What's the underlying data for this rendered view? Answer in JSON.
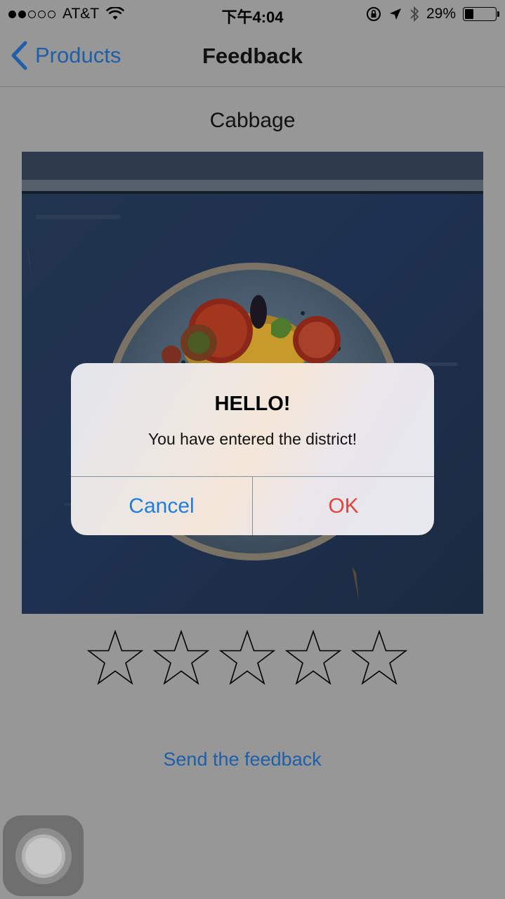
{
  "status_bar": {
    "carrier": "AT&T",
    "time": "下午4:04",
    "battery": "29%",
    "battery_level": 0.29,
    "signal_bars_filled": 2,
    "signal_bars_total": 5
  },
  "nav": {
    "back_label": "Products",
    "title": "Feedback"
  },
  "product": {
    "name": "Cabbage"
  },
  "rating": {
    "value": 0,
    "max": 5
  },
  "send_feedback_label": "Send the feedback",
  "alert": {
    "title": "HELLO!",
    "message": "You have entered the district!",
    "cancel_label": "Cancel",
    "ok_label": "OK"
  },
  "colors": {
    "link_blue": "#1d5fa8",
    "alert_cancel": "#1f7ddb",
    "alert_ok": "#e0443a",
    "overlay_background": "#979797"
  }
}
